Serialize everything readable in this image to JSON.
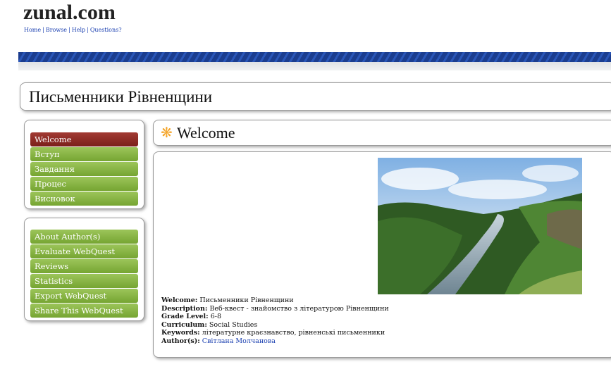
{
  "site": {
    "logo_text": "zunal.com",
    "nav": [
      "Home",
      "Browse",
      "Help",
      "Questions?"
    ]
  },
  "page_title": "Письменники Рівненщини",
  "sidebar": {
    "main_items": [
      {
        "label": "Welcome",
        "active": true
      },
      {
        "label": "Вступ",
        "active": false
      },
      {
        "label": "Завдання",
        "active": false
      },
      {
        "label": "Процес",
        "active": false
      },
      {
        "label": "Висновок",
        "active": false
      }
    ],
    "extra_items": [
      {
        "label": "About Author(s)"
      },
      {
        "label": "Evaluate WebQuest"
      },
      {
        "label": "Reviews"
      },
      {
        "label": "Statistics"
      },
      {
        "label": "Export WebQuest"
      },
      {
        "label": "Share This WebQuest"
      }
    ]
  },
  "section": {
    "icon": "flower-icon",
    "title": "Welcome"
  },
  "details": {
    "welcome_label": "Welcome:",
    "welcome_value": "Письменники Рівненщини",
    "description_label": "Description:",
    "description_value": "Веб-квест - знайомство з літературою Рівненщини",
    "grade_label": "Grade Level:",
    "grade_value": "6-8",
    "curriculum_label": "Curriculum:",
    "curriculum_value": "Social Studies",
    "keywords_label": "Keywords:",
    "keywords_value": "літературне краєзнавство, рівненські письменники",
    "authors_label": "Author(s):",
    "authors_value": "Світлана Молчанова"
  },
  "colors": {
    "menu_green": "#86b443",
    "menu_active": "#8b2a24",
    "stripe_blue": "#1b3d8f",
    "link_blue": "#1a3fb0",
    "icon_orange": "#f4a52a"
  }
}
